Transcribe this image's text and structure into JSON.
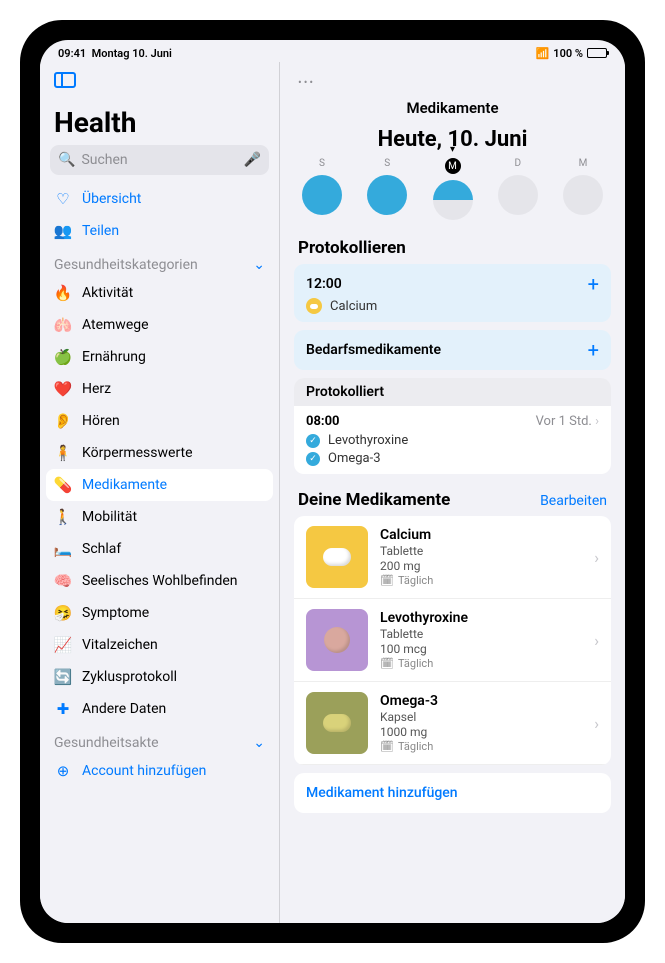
{
  "status": {
    "time": "09:41",
    "date": "Montag 10. Juni",
    "batt": "100 %",
    "wifi": "􀙇"
  },
  "app": {
    "title": "Health"
  },
  "search": {
    "placeholder": "Suchen"
  },
  "sidebar": {
    "overview": "Übersicht",
    "share": "Teilen",
    "catLabel": "Gesundheitskategorien",
    "items": [
      "Aktivität",
      "Atemwege",
      "Ernährung",
      "Herz",
      "Hören",
      "Körpermesswerte",
      "Medikamente",
      "Mobilität",
      "Schlaf",
      "Seelisches Wohlbefinden",
      "Symptome",
      "Vitalzeichen",
      "Zyklusprotokoll",
      "Andere Daten"
    ],
    "recordLabel": "Gesundheitsakte",
    "addAccount": "Account hinzufügen"
  },
  "page": {
    "title": "Medikamente",
    "heute": "Heute, 10. Juni",
    "days": [
      "S",
      "S",
      "M",
      "D",
      "M"
    ]
  },
  "log": {
    "title": "Protokollieren",
    "time": "12:00",
    "med": "Calcium",
    "asNeeded": "Bedarfsmedikamente",
    "loggedTitle": "Protokolliert",
    "loggedTime": "08:00",
    "loggedAgo": "Vor 1 Std.",
    "loggedItems": [
      "Levothyroxine",
      "Omega-3"
    ]
  },
  "meds": {
    "title": "Deine Medikamente",
    "edit": "Bearbeiten",
    "items": [
      {
        "name": "Calcium",
        "form": "Tablette",
        "dose": "200 mg",
        "freq": "Täglich"
      },
      {
        "name": "Levothyroxine",
        "form": "Tablette",
        "dose": "100 mcg",
        "freq": "Täglich"
      },
      {
        "name": "Omega-3",
        "form": "Kapsel",
        "dose": "1000 mg",
        "freq": "Täglich"
      }
    ],
    "add": "Medikament hinzufügen"
  }
}
